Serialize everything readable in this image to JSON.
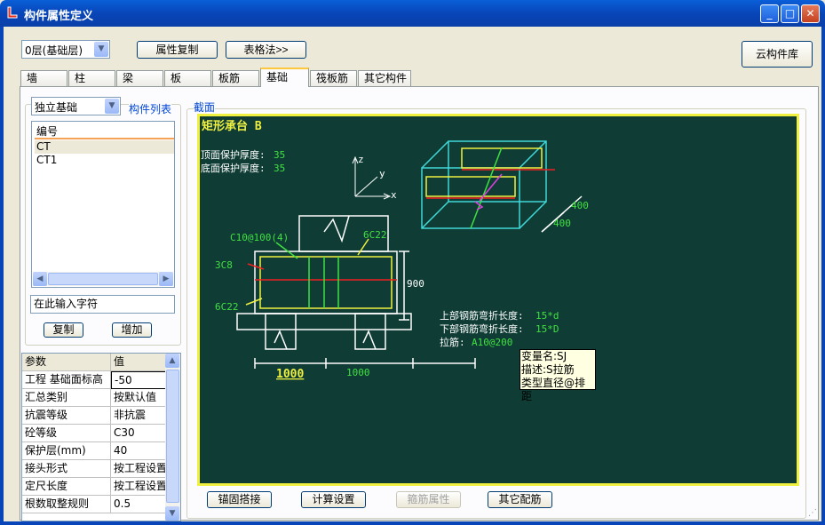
{
  "window": {
    "title": "构件属性定义",
    "buttons": {
      "minimize": "_",
      "maximize": "□",
      "close": "✕"
    }
  },
  "toolbar": {
    "floor_select": "0层(基础层)",
    "copy_props": "属性复制",
    "table_method": "表格法>>",
    "cloud_library": "云构件库"
  },
  "tabs": [
    {
      "label": "墙"
    },
    {
      "label": "柱"
    },
    {
      "label": "梁"
    },
    {
      "label": "板"
    },
    {
      "label": "板筋"
    },
    {
      "label": "基础",
      "active": true
    },
    {
      "label": "筏板筋"
    },
    {
      "label": "其它构件"
    }
  ],
  "left": {
    "type_select": "独立基础",
    "list_title": "构件列表",
    "list_header": "编号",
    "items": [
      "CT",
      "CT1"
    ],
    "search_placeholder": "在此输入字符",
    "copy_button": "复制",
    "add_button": "增加"
  },
  "params": {
    "headers": [
      "参数",
      "值"
    ],
    "rows": [
      {
        "name": "工程 基础面标高",
        "value": "-50"
      },
      {
        "name": "汇总类别",
        "value": "按默认值"
      },
      {
        "name": "抗震等级",
        "value": "非抗震"
      },
      {
        "name": "砼等级",
        "value": "C30"
      },
      {
        "name": "保护层(mm)",
        "value": "40"
      },
      {
        "name": "接头形式",
        "value": "按工程设置"
      },
      {
        "name": "定尺长度",
        "value": "按工程设置"
      },
      {
        "name": "根数取整规则",
        "value": "0.5"
      }
    ]
  },
  "section": {
    "title": "截面",
    "drawing": {
      "heading": "矩形承台 B",
      "top_cover": "顶面保护厚度:",
      "top_cover_val": "35",
      "bottom_cover": "底面保护厚度:",
      "bottom_cover_val": "35",
      "axis_z": "z",
      "axis_y": "y",
      "axis_x": "x",
      "iso_dim1": "400",
      "iso_dim2": "400",
      "stirrup": "C10@100(4)",
      "top_bar": "6C22",
      "side_bar": "3C8",
      "bottom_bar": "6C22",
      "height": "900",
      "width1": "1000",
      "width2": "1000",
      "upper_bend": "上部钢筋弯折长度:",
      "upper_bend_val": "15*d",
      "lower_bend": "下部钢筋弯折长度:",
      "lower_bend_val": "15*D",
      "tie": "拉筋:",
      "tie_val": "A10@200"
    },
    "tooltip": [
      "变量名:SJ",
      "描述:S拉筋",
      "类型直径@排距"
    ]
  },
  "bottom_buttons": {
    "anchor": "锚固搭接",
    "calc": "计算设置",
    "stirrup_prop": "箍筋属性",
    "other": "其它配筋"
  },
  "colors": {
    "drawing_bg": "#0f3d35",
    "yellow": "#f0f040",
    "cyan": "#40d8d8",
    "green": "#40e040",
    "red": "#f02020"
  }
}
